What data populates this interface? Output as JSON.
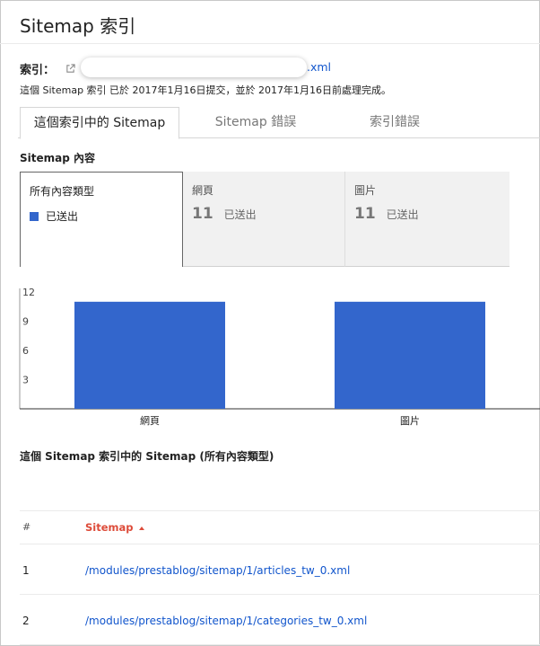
{
  "header": {
    "title": "Sitemap 索引"
  },
  "index": {
    "label": "索引：",
    "url_visible_suffix": ".xml"
  },
  "submission": {
    "text": "這個 Sitemap 索引 已於 2017年1月16日提交，並於 2017年1月16日前處理完成。"
  },
  "tabs": [
    {
      "label": "這個索引中的 Sitemap",
      "active": true
    },
    {
      "label": "Sitemap 錯誤",
      "active": false
    },
    {
      "label": "索引錯誤",
      "active": false
    }
  ],
  "content_section": {
    "title": "Sitemap 內容"
  },
  "cards": [
    {
      "label": "所有內容類型",
      "legend": "已送出",
      "selected": true
    },
    {
      "label": "網頁",
      "count": "11",
      "status": "已送出",
      "selected": false
    },
    {
      "label": "圖片",
      "count": "11",
      "status": "已送出",
      "selected": false
    }
  ],
  "chart_data": {
    "type": "bar",
    "categories": [
      "網頁",
      "圖片"
    ],
    "series": [
      {
        "name": "已送出",
        "values": [
          11,
          11
        ]
      }
    ],
    "ylim": [
      0,
      12
    ],
    "yticks": [
      3,
      6,
      9,
      12
    ],
    "color": "#3366cc",
    "grid": false
  },
  "list": {
    "title": "這個 Sitemap 索引中的 Sitemap (所有內容類型)",
    "columns": {
      "num": "#",
      "sitemap": "Sitemap"
    },
    "rows": [
      {
        "num": "1",
        "path": "/modules/prestablog/sitemap/1/articles_tw_0.xml"
      },
      {
        "num": "2",
        "path": "/modules/prestablog/sitemap/1/categories_tw_0.xml"
      }
    ]
  },
  "colors": {
    "link": "#1155cc",
    "accent": "#dd4b39",
    "bar": "#3366cc"
  }
}
